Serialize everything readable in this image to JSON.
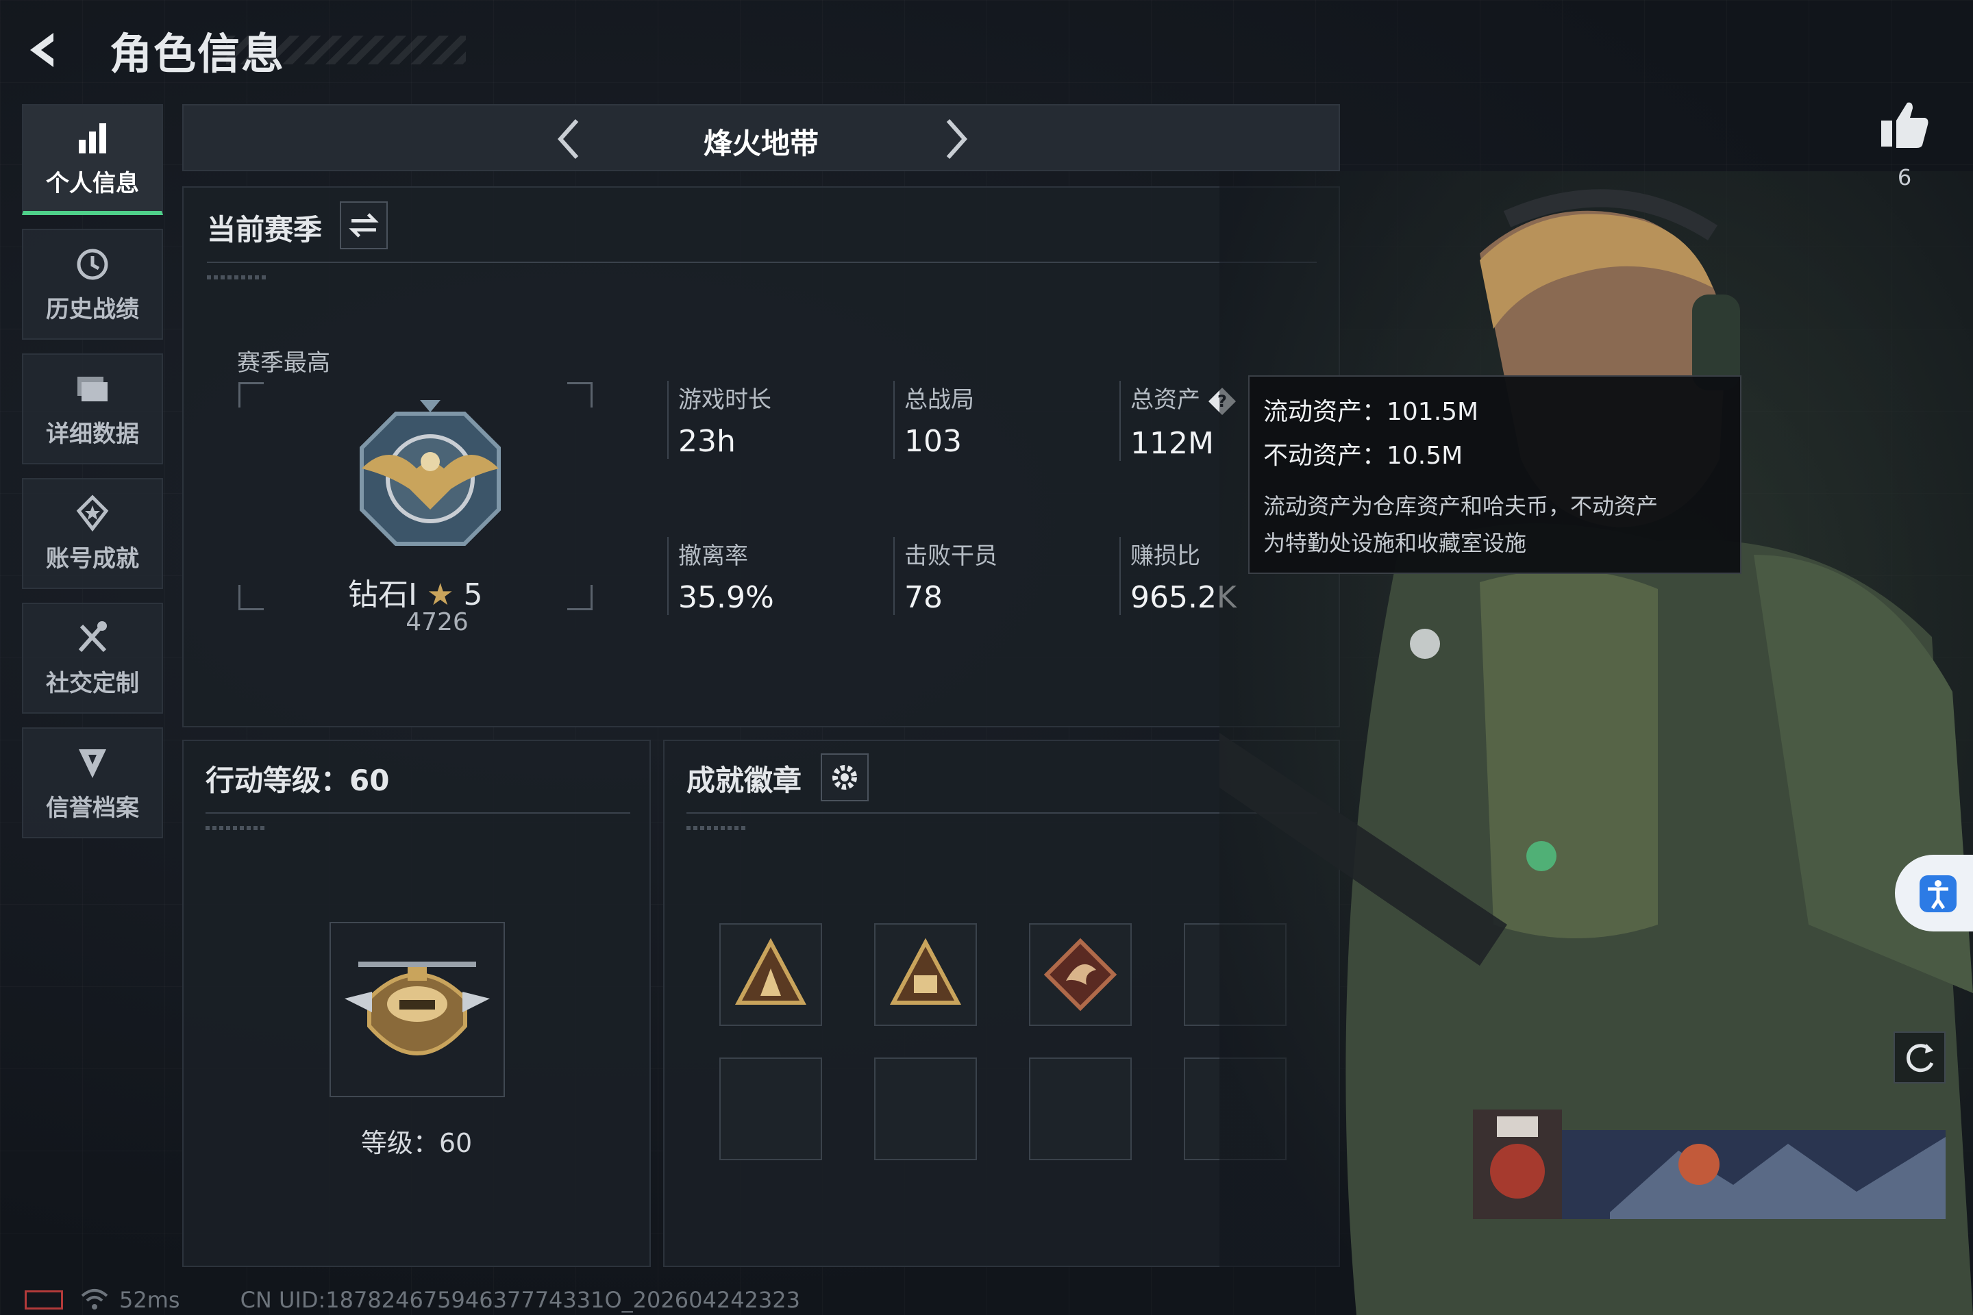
{
  "header": {
    "title": "角色信息"
  },
  "sidebar": {
    "items": [
      {
        "label": "个人信息",
        "active": true
      },
      {
        "label": "历史战绩"
      },
      {
        "label": "详细数据"
      },
      {
        "label": "账号成就"
      },
      {
        "label": "社交定制"
      },
      {
        "label": "信誉档案"
      }
    ]
  },
  "mode_bar": {
    "title": "烽火地带"
  },
  "season": {
    "title": "当前赛季",
    "max_label": "赛季最高",
    "rank_name": "钻石Ⅰ",
    "rank_stars": "5",
    "rank_score": "4726",
    "stats": [
      {
        "label": "游戏时长",
        "value": "23h"
      },
      {
        "label": "总战局",
        "value": "103"
      },
      {
        "label": "总资产",
        "value": "112M"
      },
      {
        "label": "撤离率",
        "value": "35.9%"
      },
      {
        "label": "击败干员",
        "value": "78"
      },
      {
        "label": "赚损比",
        "value": "965.2K"
      }
    ]
  },
  "tooltip": {
    "liquid": "流动资产：101.5M",
    "fixed": "不动资产：10.5M",
    "desc_line1": "流动资产为仓库资产和哈夫币，不动资产",
    "desc_line2": "为特勤处设施和收藏室设施"
  },
  "action_level": {
    "title": "行动等级：60",
    "level_text": "等级：60"
  },
  "badges": {
    "title": "成就徽章",
    "slots_filled": 3,
    "slots_total": 8
  },
  "social": {
    "likes": "6"
  },
  "status_bar": {
    "ping": "52ms",
    "uid": "CN UID:18782467594637774331O_202604242323"
  },
  "colors": {
    "accent_green": "#4fd08a",
    "tooltip_bg": "#0e1013",
    "badge_gold": "#c9a45c"
  }
}
